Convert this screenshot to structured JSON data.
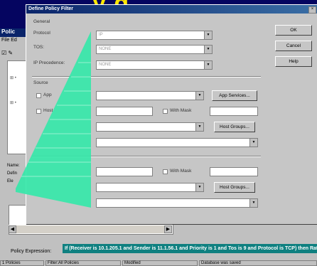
{
  "background_title": "y  g",
  "app": {
    "title": "Polic",
    "menu": "File Ed",
    "toolbar": "☑ ✎",
    "tree_items": [
      "⊞ •",
      "⊞ •"
    ],
    "props": [
      "Name:",
      "Defin",
      "Ele"
    ],
    "policy_expression_label": "Policy Expression:",
    "policy_expression": "If (Receiver is 10.1.205.1 and Sender is 11.1.56.1 and Priority is 1 and Tos is 9 and Protocol is TCP) then Rat",
    "status": {
      "policies": "1 Policies",
      "filter": "Filter:All Policies",
      "modified": "Modified",
      "saved": "Database was saved"
    }
  },
  "dialog": {
    "title": "Define Policy Filter",
    "close": "×",
    "general_label": "General",
    "protocol_label": "Protocol",
    "protocol_value": "IP",
    "tos_label": "TOS:",
    "tos_value": "NONE",
    "precedence_label": "IP Precedence:",
    "precedence_value": "NONE",
    "source_label": "Source",
    "app_label": "App",
    "host_label": "Host",
    "with_mask_label": "With Mask",
    "app_services_button": "App Services...",
    "host_groups_button": "Host Groups...",
    "host_groups_button_2": "Host Groups...",
    "with_mask_label_2": "With Mask",
    "ok_button": "OK",
    "cancel_button": "Cancel",
    "help_button": "Help"
  }
}
